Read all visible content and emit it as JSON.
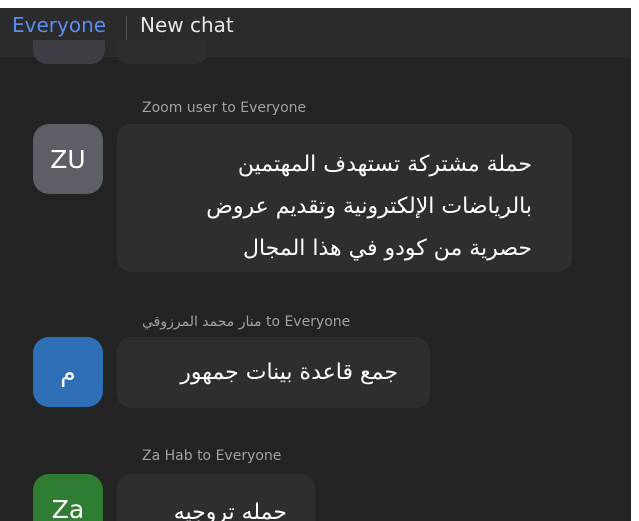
{
  "header": {
    "tab_everyone": "Everyone",
    "tab_new_chat": "New chat"
  },
  "messages": [
    {
      "sender": "Zoom user to Everyone",
      "avatar_text": "ZU",
      "avatar_color": "#5c5f66",
      "text": "حملة مشتركة تستهدف المهتمين\nبالرياضات الإلكترونية وتقديم عروض\nحصرية من كودو في هذا المجال"
    },
    {
      "sender": "منار محمد المرزوقي to Everyone",
      "avatar_text": "م",
      "avatar_color": "#2e6fb8",
      "text": "جمع قاعدة بينات جمهور"
    },
    {
      "sender": "Za Hab to Everyone",
      "avatar_text": "Za",
      "avatar_color": "#2f7d32",
      "text": "حمله تروجيه"
    }
  ],
  "colors": {
    "background": "#232323",
    "bubble": "#2e2e2e",
    "accent": "#5b8def"
  }
}
